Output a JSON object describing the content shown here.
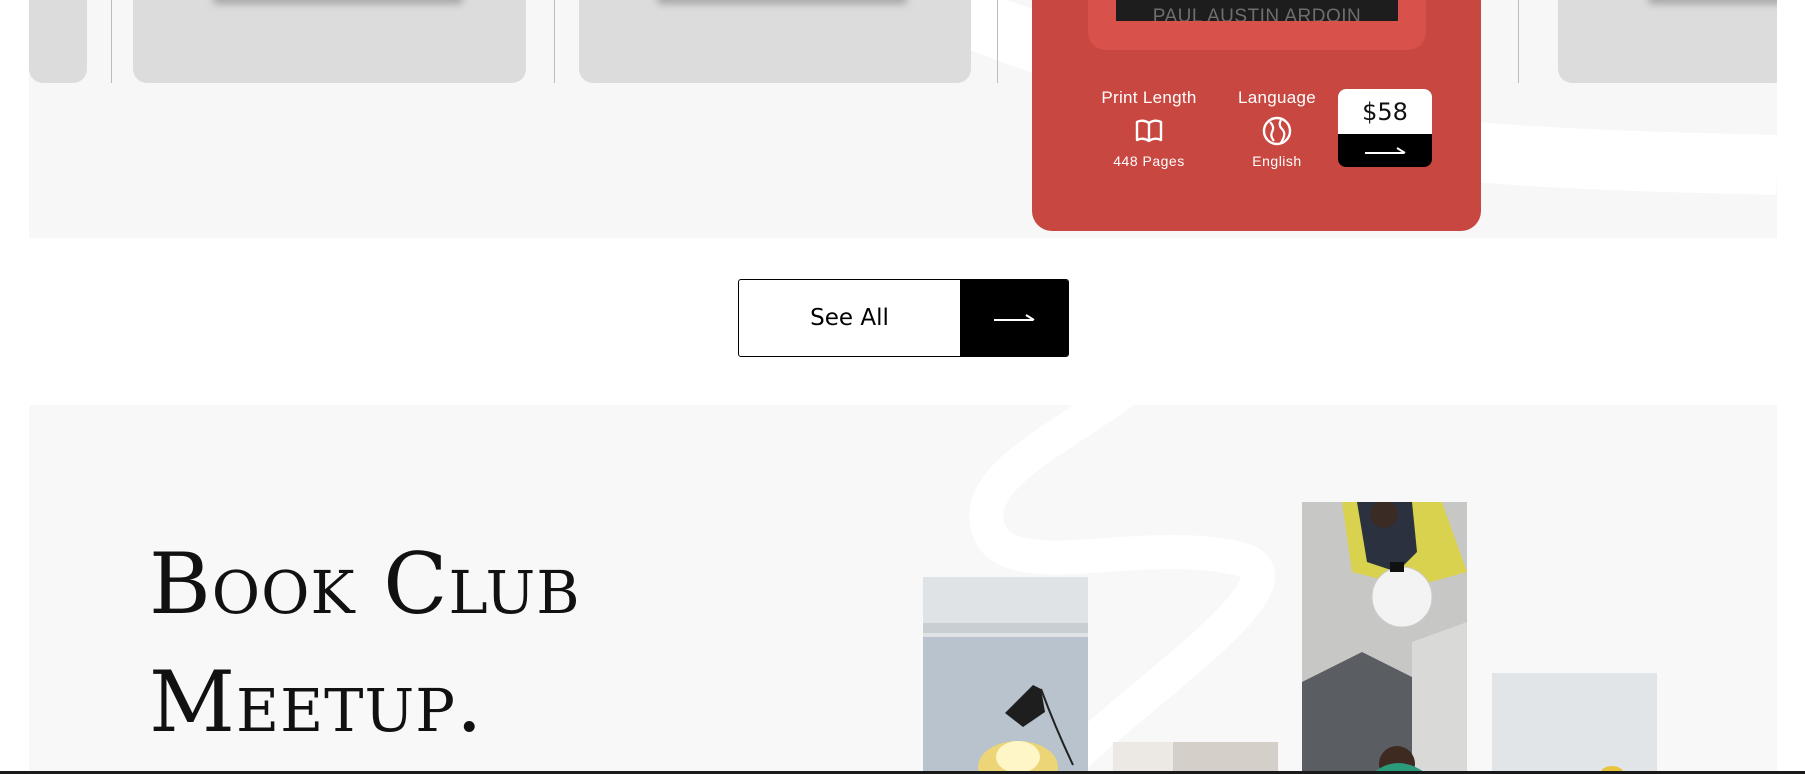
{
  "featured_book": {
    "author": "PAUL AUSTIN ARDOIN",
    "print_length_label": "Print Length",
    "print_length_value": "448 Pages",
    "language_label": "Language",
    "language_value": "English",
    "price": "$58",
    "icons": {
      "length": "open-book-icon",
      "language": "globe-icon",
      "buy": "arrow-right-icon"
    }
  },
  "see_all": {
    "label": "See All",
    "icon": "arrow-right-icon"
  },
  "book_club": {
    "heading_line1": "Book Club",
    "heading_line2": "Meetup."
  },
  "colors": {
    "accent_red": "#c94741",
    "accent_red_light": "#d8524b",
    "black": "#000000",
    "section_bg": "#f8f8f8"
  }
}
